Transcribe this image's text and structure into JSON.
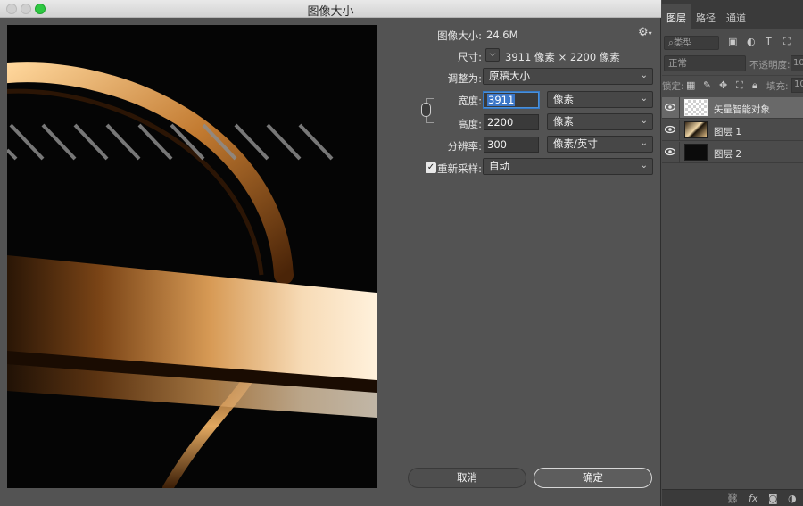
{
  "dialog": {
    "title": "图像大小",
    "image_size_label": "图像大小:",
    "image_size_value": "24.6M",
    "dimensions_label": "尺寸:",
    "dimensions_value": "3911 像素  ×  2200 像素",
    "fit_to_label": "调整为:",
    "fit_to_value": "原稿大小",
    "width_label": "宽度:",
    "width_value": "3911",
    "width_unit": "像素",
    "height_label": "高度:",
    "height_value": "2200",
    "height_unit": "像素",
    "resolution_label": "分辨率:",
    "resolution_value": "300",
    "resolution_unit": "像素/英寸",
    "resample_label": "重新采样:",
    "resample_checked": true,
    "resample_value": "自动",
    "cancel_label": "取消",
    "ok_label": "确定"
  },
  "layers_panel": {
    "tabs": [
      "图层",
      "路径",
      "通道"
    ],
    "active_tab": "图层",
    "filter_placeholder": "类型",
    "blend_mode": "正常",
    "opacity_label": "不透明度:",
    "opacity_value": "10",
    "lock_label": "锁定:",
    "fill_label": "填充:",
    "fill_value": "10",
    "layers": [
      {
        "name": "矢量智能对象",
        "thumb": "checker",
        "selected": true
      },
      {
        "name": "图层 1",
        "thumb": "img",
        "selected": false
      },
      {
        "name": "图层 2",
        "thumb": "dark",
        "selected": false
      }
    ],
    "bottom_icons": [
      "link-icon",
      "fx-icon",
      "mask-icon",
      "adjustment-icon"
    ]
  },
  "colors": {
    "dialog_bg": "#535353",
    "panel_bg": "#4b4b4b",
    "selection_blue": "#3c77c8",
    "gold": "#d8a25a"
  }
}
